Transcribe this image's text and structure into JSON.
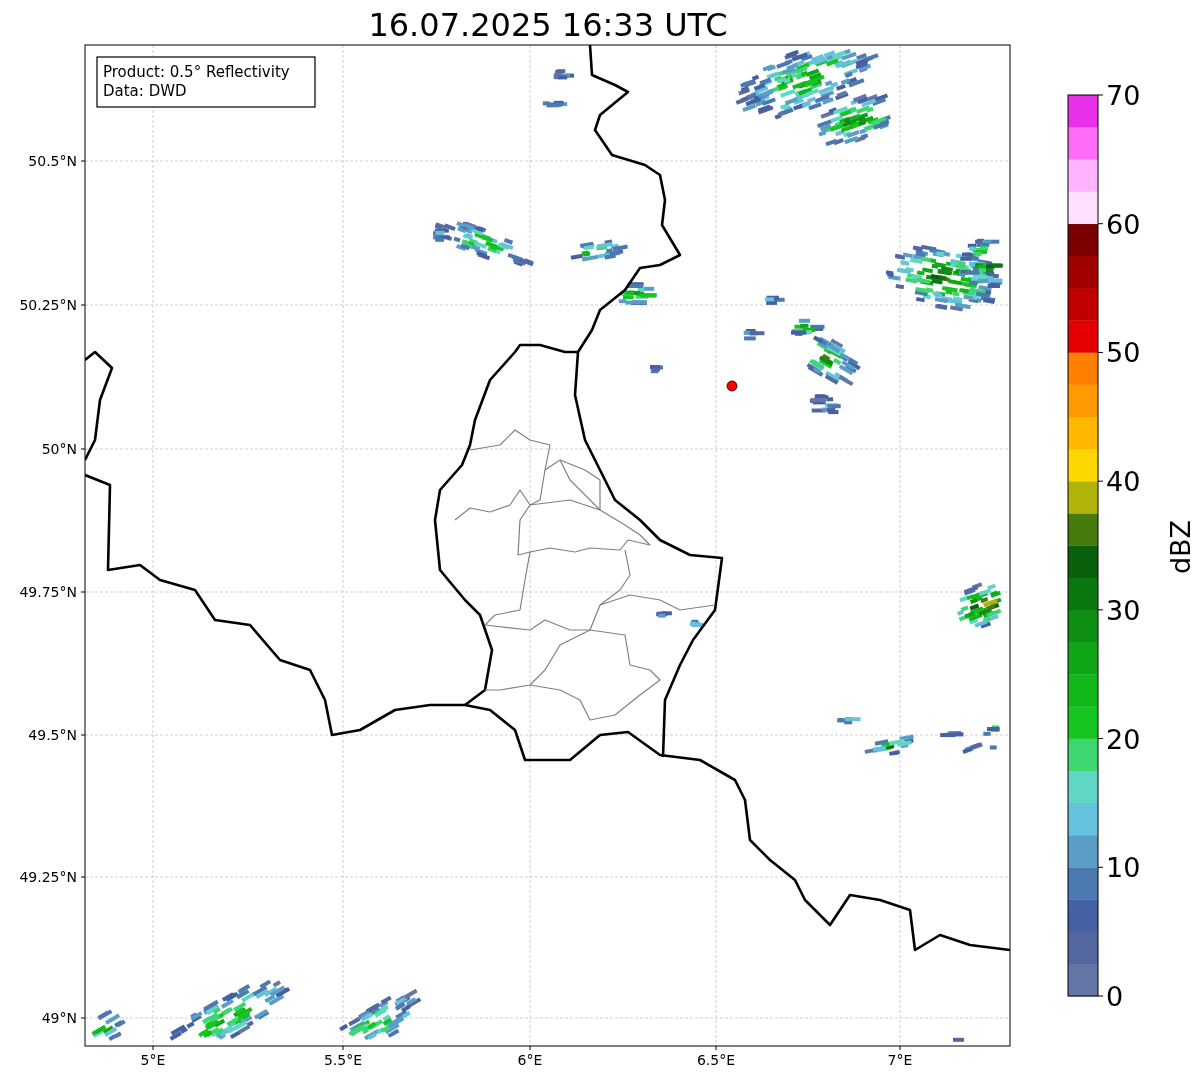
{
  "title": "16.07.2025 16:33 UTC",
  "info_box": [
    "Product: 0.5° Reflectivity",
    "Data: DWD"
  ],
  "x_tick_labels": [
    "5°E",
    "5.5°E",
    "6°E",
    "6.5°E",
    "7°E"
  ],
  "y_tick_labels": [
    "50.5°N",
    "50.25°N",
    "50°N",
    "49.75°N",
    "49.5°N",
    "49.25°N",
    "49°N"
  ],
  "colorbar": {
    "label": "dBZ",
    "tick_labels": [
      "70",
      "60",
      "50",
      "40",
      "30",
      "20",
      "10",
      "0"
    ],
    "segments": [
      {
        "color": "#6475a6"
      },
      {
        "color": "#5567a0"
      },
      {
        "color": "#4560a3"
      },
      {
        "color": "#4b79b0"
      },
      {
        "color": "#5a9ec8"
      },
      {
        "color": "#66c1dc"
      },
      {
        "color": "#60d7c4"
      },
      {
        "color": "#3dd670"
      },
      {
        "color": "#14c61f"
      },
      {
        "color": "#12b81a"
      },
      {
        "color": "#10a617"
      },
      {
        "color": "#0e8f14"
      },
      {
        "color": "#0b7711"
      },
      {
        "color": "#085f0c"
      },
      {
        "color": "#477a0c"
      },
      {
        "color": "#b0b40a"
      },
      {
        "color": "#ffd700"
      },
      {
        "color": "#ffb800"
      },
      {
        "color": "#ff9b00"
      },
      {
        "color": "#ff7f00"
      },
      {
        "color": "#e40000"
      },
      {
        "color": "#c00000"
      },
      {
        "color": "#a00000"
      },
      {
        "color": "#7b0000"
      },
      {
        "color": "#ffe0ff"
      },
      {
        "color": "#ffb4ff"
      },
      {
        "color": "#ff6cf7"
      },
      {
        "color": "#e830e8"
      }
    ]
  }
}
